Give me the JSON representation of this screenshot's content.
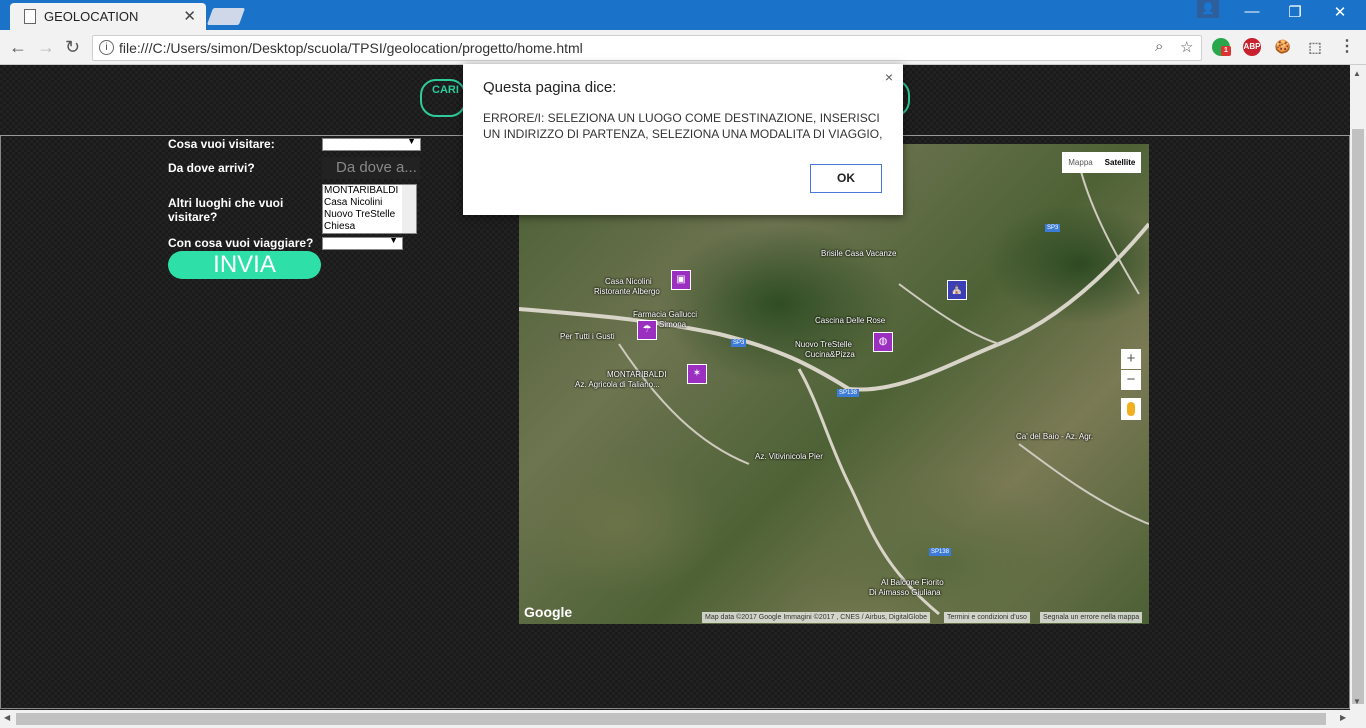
{
  "browser": {
    "tab_title": "GEOLOCATION",
    "tab_close": "✕",
    "url": "file:///C:/Users/simon/Desktop/scuola/TPSI/geolocation/progetto/home.html",
    "window": {
      "minimize": "—",
      "restore": "❐",
      "close": "✕"
    },
    "nav": {
      "back": "←",
      "forward": "→",
      "reload": "↻"
    },
    "omnibox_icons": {
      "info": "i",
      "zoom": "⌕",
      "star": "☆"
    },
    "extensions": [
      {
        "name": "evernote-icon",
        "label": "",
        "badge": "1"
      },
      {
        "name": "adblock-plus-icon",
        "label": "ABP"
      },
      {
        "name": "cookie-icon",
        "label": "🍪"
      },
      {
        "name": "extension-icon",
        "label": "⬚"
      }
    ],
    "menu_icon": "⋮"
  },
  "header": {
    "button_left": "CARI",
    "button_right": ""
  },
  "form": {
    "visit_label": "Cosa vuoi visitare:",
    "from_label": "Da dove arrivi?",
    "from_placeholder": "Da dove a...",
    "others_label": "Altri luoghi che vuoi visitare?",
    "others_options": [
      "MONTARIBALDI",
      "Casa Nicolini",
      "Nuovo TreStelle",
      "Chiesa"
    ],
    "mode_label": "Con cosa vuoi viaggiare?",
    "submit_label": "INVIA"
  },
  "map": {
    "type_map": "Mappa",
    "type_satellite": "Satellite",
    "zoom_in": "+",
    "zoom_out": "−",
    "logo": "Google",
    "attribution": "Map data ©2017 Google Immagini ©2017 , CNES / Airbus, DigitalGlobe",
    "terms": "Termini e condizioni d'uso",
    "report": "Segnala un errore nella mappa",
    "labels": {
      "brisile": "Brisile Casa Vacanze",
      "casa_nicolini_1": "Casa Nicolini",
      "casa_nicolini_2": "Ristorante Albergo",
      "farmacia_1": "Farmacia Gallucci",
      "farmacia_2": "Simona",
      "per_tutti": "Per Tutti i Gusti",
      "montaribaldi_1": "MONTARIBALDI",
      "montaribaldi_2": "Az. Agricola di Taliano...",
      "cascina": "Cascina Delle Rose",
      "nuovo_1": "Nuovo TreStelle",
      "nuovo_2": "Cucina&Pizza",
      "baio": "Ca' del Baio - Az. Agr.",
      "vitivinicola": "Az. Vitivinicola Pier",
      "balcone_1": "Al Balcone Fiorito",
      "balcone_2": "Di Aimasso Giuliana"
    },
    "road_signs": {
      "sp3_a": "SP3",
      "sp3_b": "SP3",
      "sp138_a": "SP138",
      "sp138_b": "SP138"
    }
  },
  "dialog": {
    "title": "Questa pagina dice:",
    "close": "×",
    "message": "ERRORE/I: SELEZIONA UN LUOGO COME DESTINAZIONE, INSERISCI UN INDIRIZZO DI PARTENZA, SELEZIONA UNA MODALITA DI VIAGGIO,",
    "ok_label": "OK"
  },
  "scrollbars": {
    "up": "▲",
    "down": "▼",
    "left": "◀",
    "right": "▶"
  }
}
